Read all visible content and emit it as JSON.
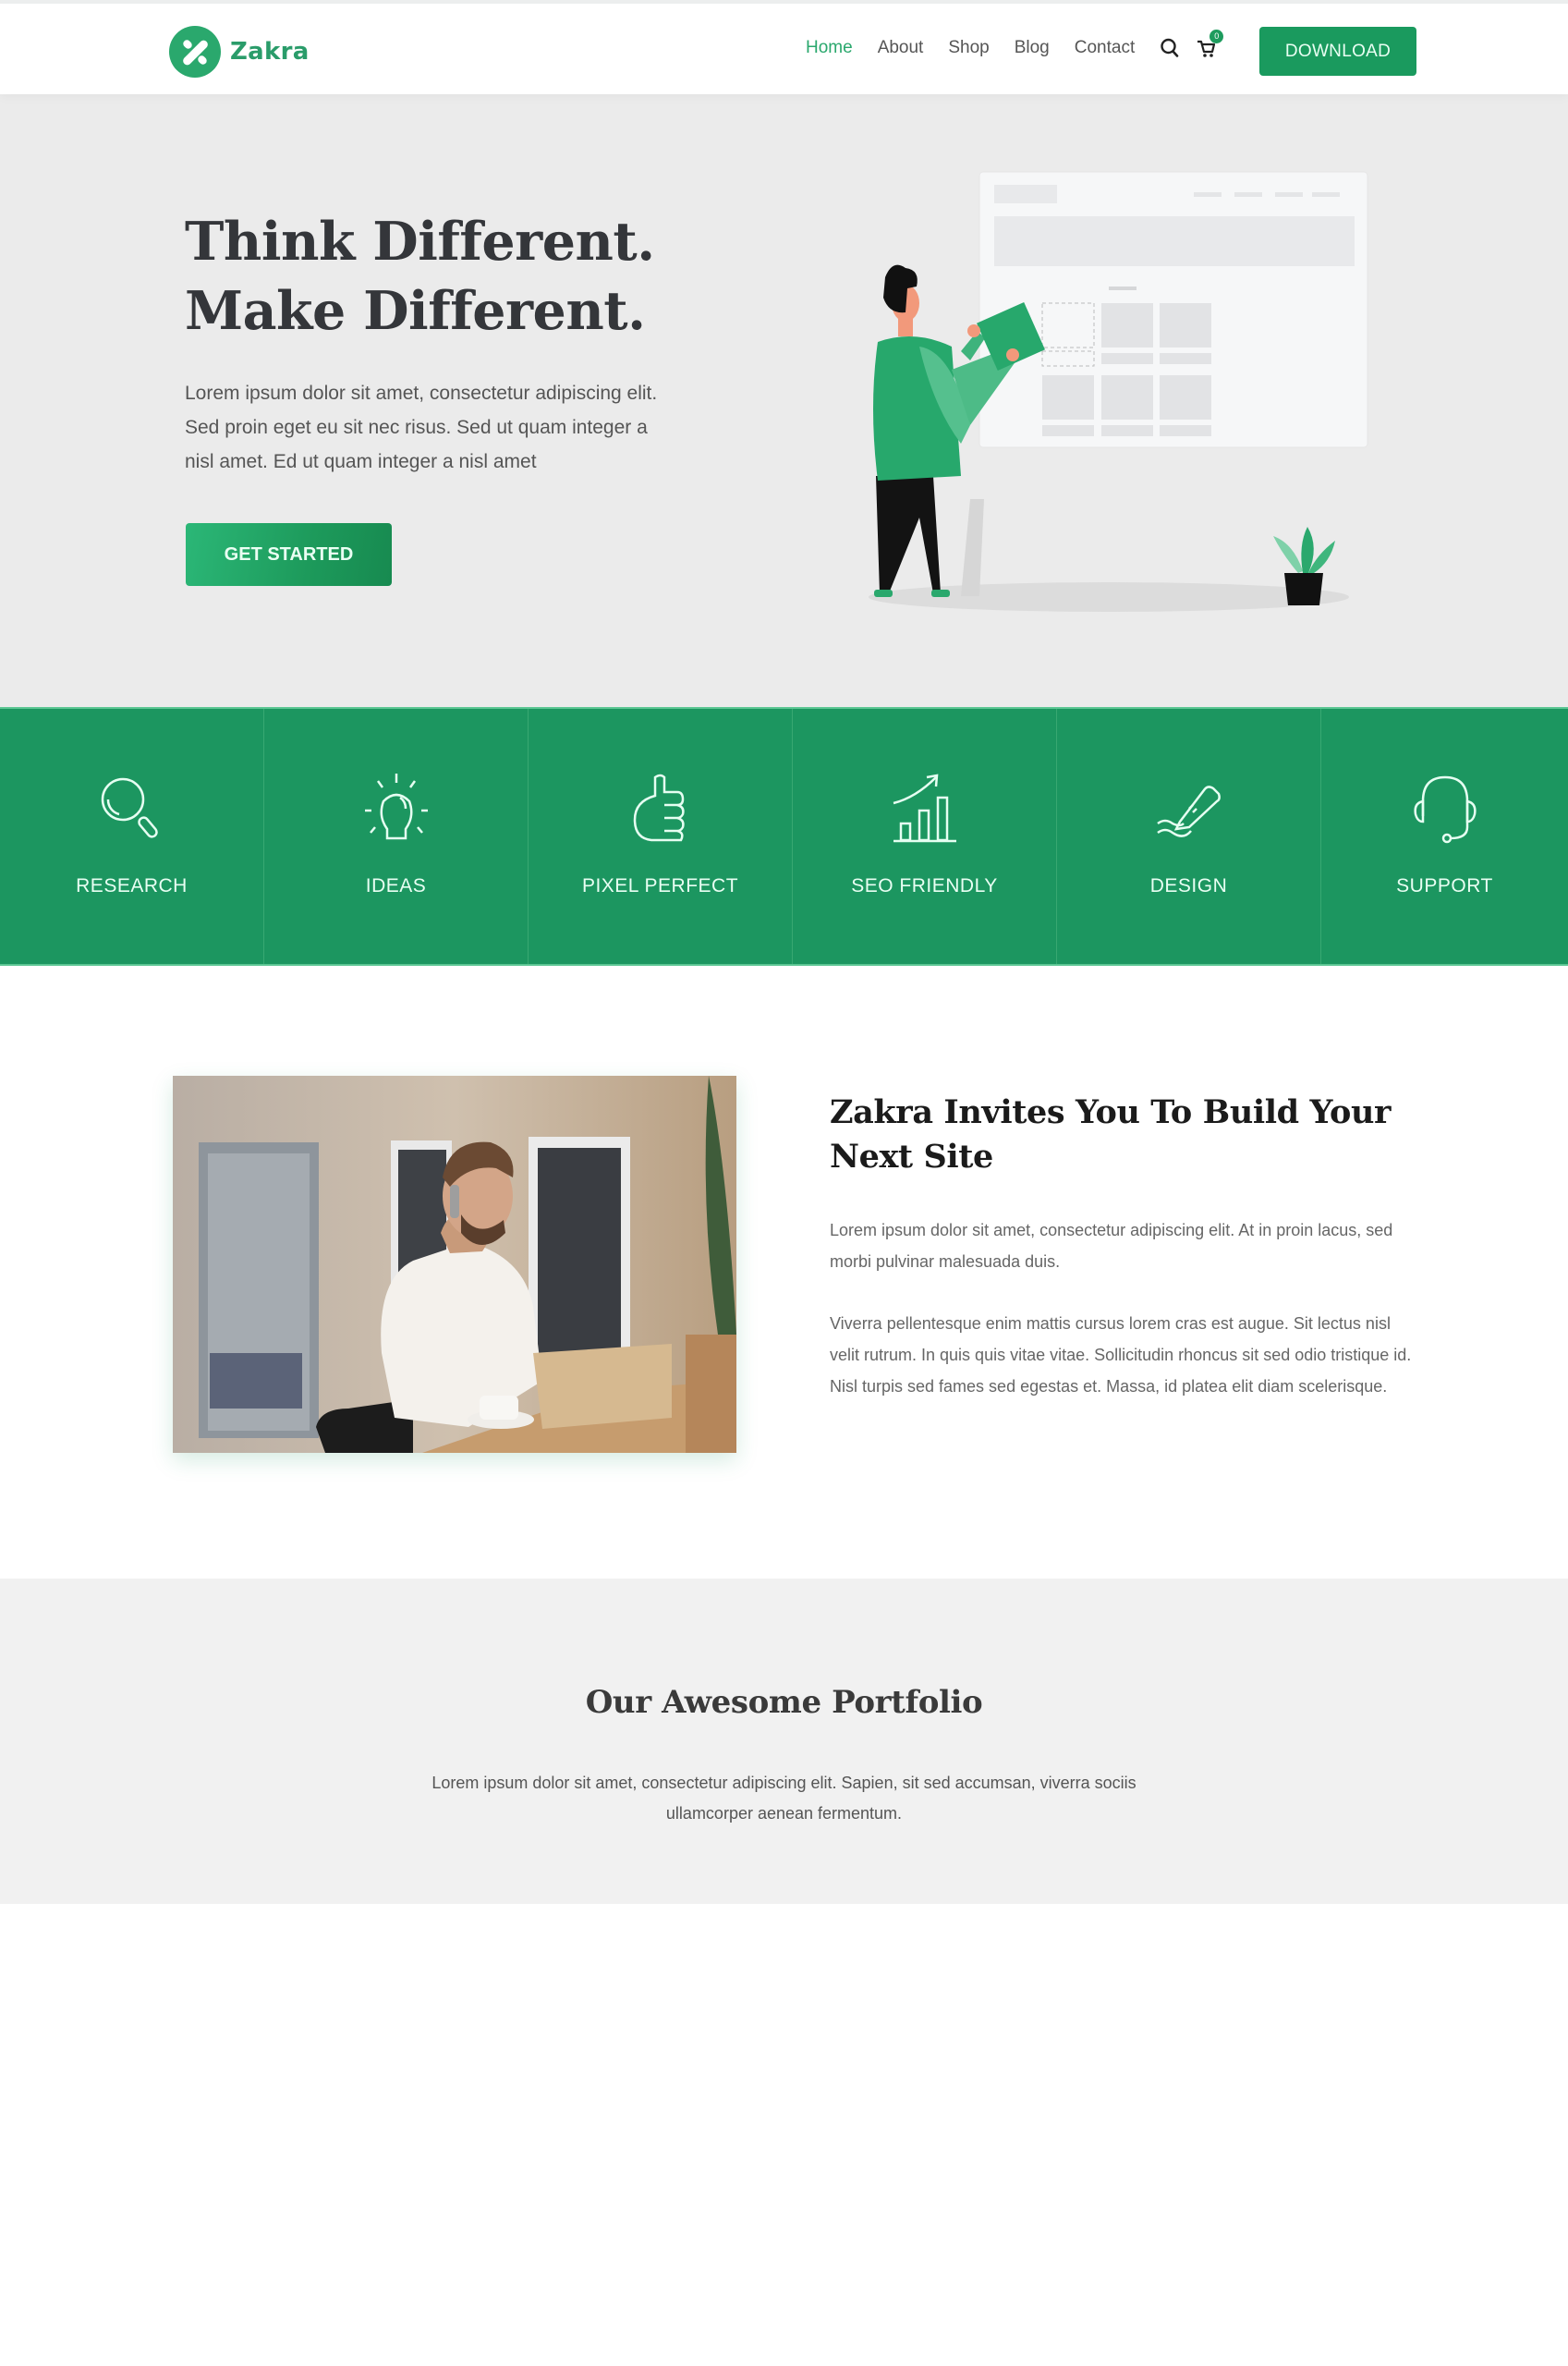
{
  "brand": {
    "name": "Zakra",
    "accent": "#2aa86d",
    "dark_green": "#1c9660"
  },
  "nav": {
    "items": [
      {
        "label": "Home",
        "active": true
      },
      {
        "label": "About",
        "active": false
      },
      {
        "label": "Shop",
        "active": false
      },
      {
        "label": "Blog",
        "active": false
      },
      {
        "label": "Contact",
        "active": false
      }
    ],
    "search_icon": "search-icon",
    "cart_icon": "cart-icon",
    "cart_count": "0",
    "download_label": "DOWNLOAD"
  },
  "hero": {
    "title_line1": "Think Different.",
    "title_line2": "Make Different.",
    "text": "Lorem ipsum dolor sit amet, consectetur adipiscing elit. Sed proin eget eu sit nec risus. Sed ut quam integer a nisl amet.  Ed ut quam integer a nisl amet",
    "cta_label": "GET STARTED"
  },
  "features": [
    {
      "label": "RESEARCH",
      "icon": "magnifier-icon"
    },
    {
      "label": "IDEAS",
      "icon": "lightbulb-icon"
    },
    {
      "label": "PIXEL PERFECT",
      "icon": "thumbs-up-icon"
    },
    {
      "label": "SEO FRIENDLY",
      "icon": "growth-chart-icon"
    },
    {
      "label": "DESIGN",
      "icon": "pen-icon"
    },
    {
      "label": "SUPPORT",
      "icon": "headset-icon"
    }
  ],
  "about": {
    "title": "Zakra Invites You To Build Your Next Site",
    "p1": "Lorem ipsum dolor sit amet, consectetur adipiscing elit. At in proin lacus, sed morbi pulvinar malesuada duis.",
    "p2": "Viverra pellentesque enim mattis cursus lorem cras est augue. Sit lectus nisl velit rutrum. In quis quis vitae vitae. Sollicitudin rhoncus sit sed odio tristique id. Nisl turpis sed fames sed egestas et. Massa, id platea elit diam scelerisque."
  },
  "portfolio": {
    "title": "Our Awesome Portfolio",
    "text": "Lorem ipsum dolor sit amet, consectetur adipiscing elit. Sapien, sit sed accumsan, viverra sociis ullamcorper aenean fermentum."
  }
}
